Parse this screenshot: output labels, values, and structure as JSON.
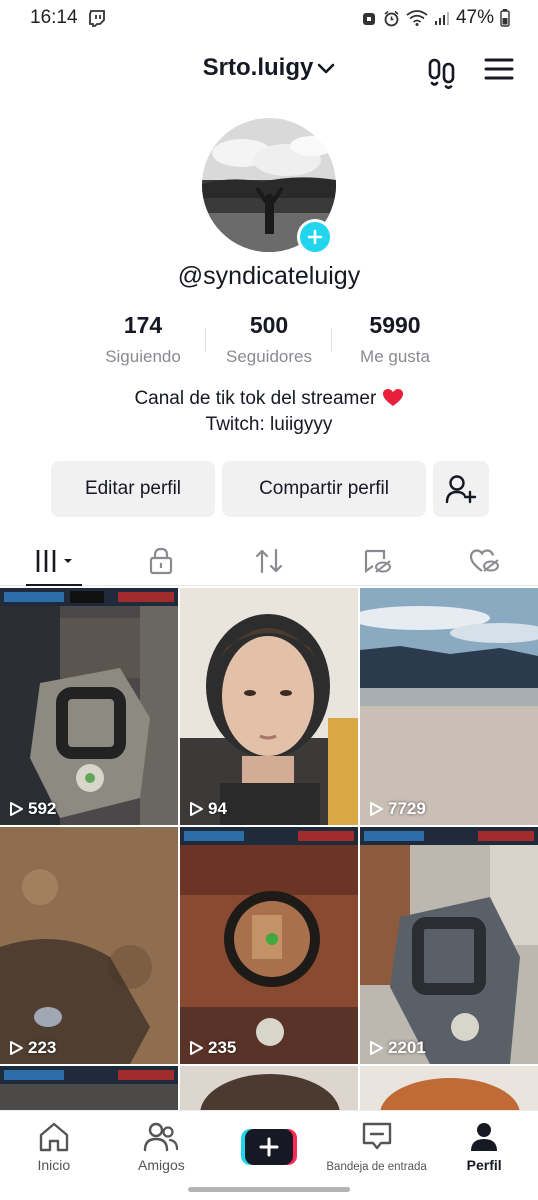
{
  "status_bar": {
    "time": "16:14",
    "battery": "47%"
  },
  "header": {
    "username": "Srto.luigy"
  },
  "profile": {
    "handle": "@syndicateluigy",
    "stats": [
      {
        "value": "174",
        "label": "Siguiendo"
      },
      {
        "value": "500",
        "label": "Seguidores"
      },
      {
        "value": "5990",
        "label": "Me gusta"
      }
    ],
    "bio_line1": "Canal de tik tok del streamer",
    "bio_line2": "Twitch: luiigyyy"
  },
  "actions": {
    "edit": "Editar perfil",
    "share": "Compartir perfil"
  },
  "videos": [
    {
      "views": "592"
    },
    {
      "views": "94"
    },
    {
      "views": "7729"
    },
    {
      "views": "223"
    },
    {
      "views": "235"
    },
    {
      "views": "2201"
    }
  ],
  "nav": {
    "home": "Inicio",
    "friends": "Amigos",
    "inbox": "Bandeja de entrada",
    "profile": "Perfil"
  },
  "colors": {
    "accent_cyan": "#20d5ec",
    "accent_red": "#fe2c55",
    "text": "#161823",
    "muted": "#8a8b91"
  }
}
